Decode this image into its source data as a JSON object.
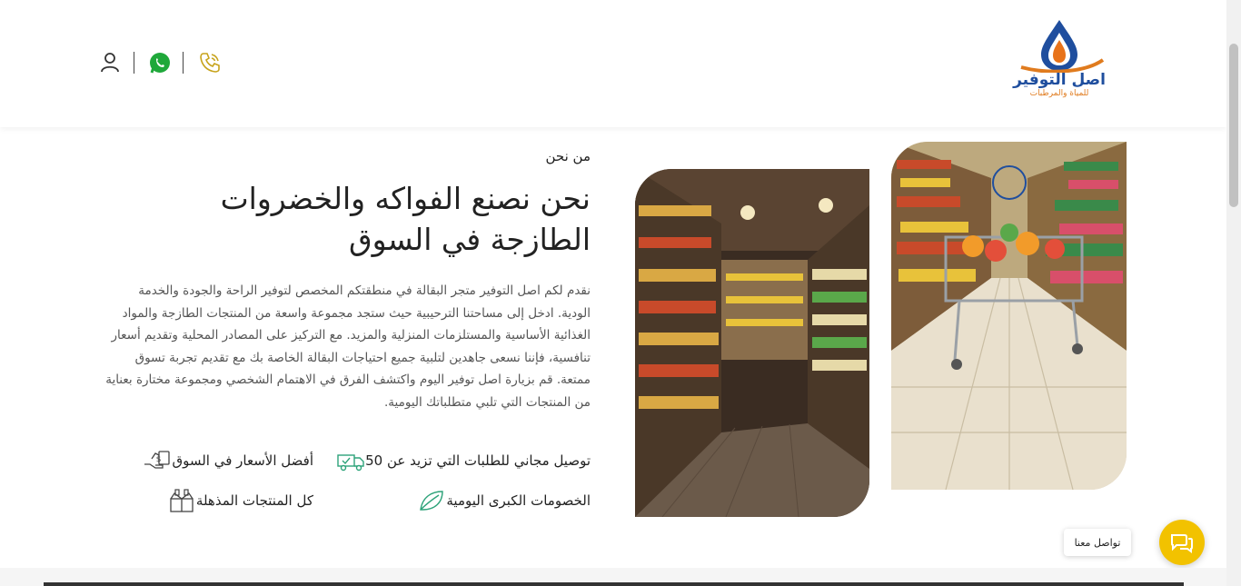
{
  "brand": {
    "name": "اصل التوفير",
    "tagline": "للمياة والمرطبات",
    "colors": {
      "primary": "#1f4e9e",
      "accent": "#e07b1e"
    }
  },
  "header_icons": [
    "user-icon",
    "whatsapp-icon",
    "phone-icon"
  ],
  "about": {
    "section_label": "من نحن",
    "headline": "نحن نصنع الفواكه والخضروات الطازجة في السوق",
    "paragraph": "نقدم لكم اصل التوفير متجر البقالة في منطقتكم المخصص لتوفير الراحة والجودة والخدمة الودية. ادخل إلى مساحتنا الترحيبية حيث ستجد مجموعة واسعة من المنتجات الطازجة والمواد الغذائية الأساسية والمستلزمات المنزلية والمزيد. مع التركيز على المصادر المحلية وتقديم أسعار تنافسية، فإننا نسعى جاهدين لتلبية جميع احتياجات البقالة الخاصة بك مع تقديم تجربة تسوق ممتعة. قم بزيارة اصل توفير اليوم واكتشف الفرق في الاهتمام الشخصي ومجموعة مختارة بعناية من المنتجات التي تلبي متطلباتك اليومية."
  },
  "features": [
    {
      "label": "توصيل مجاني للطلبات التي تزيد عن 50",
      "icon": "delivery-truck-icon"
    },
    {
      "label": "أفضل الأسعار في السوق",
      "icon": "price-tag-hand-icon"
    },
    {
      "label": "الخصومات الكبرى اليومية",
      "icon": "leaf-icon"
    },
    {
      "label": "كل المنتجات المذهلة",
      "icon": "products-box-icon"
    }
  ],
  "chat": {
    "label": "تواصل معنا"
  },
  "colors": {
    "chat_button": "#f2c200",
    "whatsapp": "#1fa83a",
    "phone": "#c7a31c"
  }
}
